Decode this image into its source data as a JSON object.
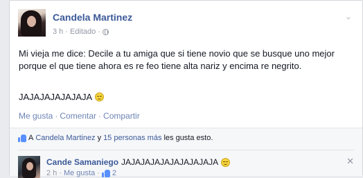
{
  "post": {
    "author": "Candela Martinez",
    "time": "3 h",
    "edited": "Editado",
    "meta_sep": "·",
    "privacy_icon": "globe-icon",
    "menu_icon": "chevron-down-icon",
    "text": "Mi vieja me dice: Decile a tu amiga que si tiene novio que se busque uno mejor porque el que tiene ahora es re feo tiene alta nariz y encima re negrito.",
    "laugh_text": "JAJAJAJAJAJAJA",
    "emoji_icon": "grinning-face-icon"
  },
  "actions": {
    "like": "Me gusta",
    "comment": "Comentar",
    "share": "Compartir",
    "sep": "·"
  },
  "likes": {
    "prefix": "A",
    "name": "Candela Martinez",
    "conj": "y",
    "others": "15 personas más",
    "suffix": "les gusta esto."
  },
  "comment": {
    "author": "Cande Samaniego",
    "text": "JAJAJAJAJAJAJAJAJAJA",
    "time": "2 h",
    "like": "Me gusta",
    "like_count": "2",
    "close_icon": "close-icon",
    "sep": "·"
  }
}
